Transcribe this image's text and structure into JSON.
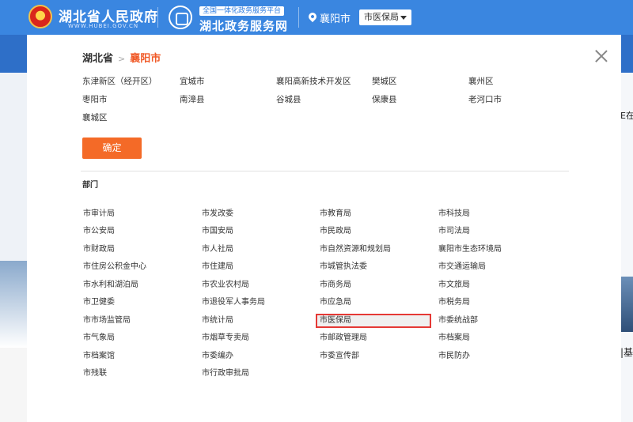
{
  "header": {
    "site_name": "湖北省人民政府",
    "site_url": "WWW.HUBEI.GOV.CN",
    "platform_tag": "全国一体化政务服务平台",
    "platform_name": "湖北政务服务网",
    "location_city": "襄阳市",
    "department_select": "市医保局"
  },
  "background": {
    "right_text_1": "E在",
    "right_text_2": "|基"
  },
  "panel": {
    "breadcrumb": {
      "province": "湖北省",
      "separator": ">",
      "city": "襄阳市"
    },
    "districts": [
      "东津新区（经开区）",
      "宜城市",
      "襄阳高新技术开发区",
      "樊城区",
      "襄州区",
      "枣阳市",
      "南漳县",
      "谷城县",
      "保康县",
      "老河口市",
      "襄城区"
    ],
    "confirm_label": "确定",
    "department_heading": "部门",
    "departments": [
      "市审计局",
      "市发改委",
      "市教育局",
      "市科技局",
      "市公安局",
      "市国安局",
      "市民政局",
      "市司法局",
      "市财政局",
      "市人社局",
      "市自然资源和规划局",
      "襄阳市生态环境局",
      "市住房公积金中心",
      "市住建局",
      "市城管执法委",
      "市交通运输局",
      "市水利和湖泊局",
      "市农业农村局",
      "市商务局",
      "市文旅局",
      "市卫健委",
      "市退役军人事务局",
      "市应急局",
      "市税务局",
      "市市场监管局",
      "市统计局",
      "市医保局",
      "市委统战部",
      "市气象局",
      "市烟草专卖局",
      "市邮政管理局",
      "市档案局",
      "市档案馆",
      "市委编办",
      "市委宣传部",
      "市民防办",
      "市残联",
      "市行政审批局"
    ],
    "selected_department": "市医保局",
    "colors": {
      "accent": "#f46a27",
      "selection_border": "#e53935",
      "header_blue": "#3a86e0"
    }
  }
}
